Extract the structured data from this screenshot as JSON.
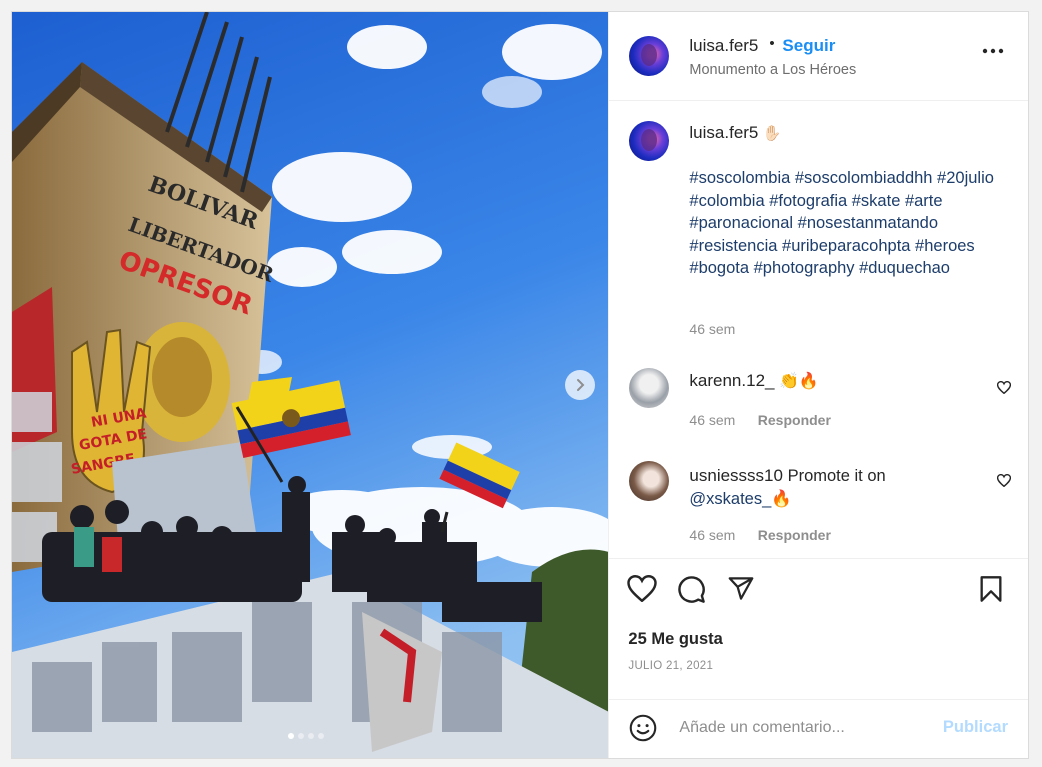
{
  "header": {
    "username": "luisa.fer5",
    "separator": "•",
    "follow_label": "Seguir",
    "location": "Monumento a Los Héroes"
  },
  "caption": {
    "username": "luisa.fer5",
    "emoji": "✋🏻",
    "hashtags": "#soscolombia #soscolombiaddhh #20julio #colombia #fotografia #skate #arte #paronacional #nosestanmatando #resistencia #uribeparacohpta #heroes #bogota #photography #duquechao",
    "time": "46 sem"
  },
  "comments": [
    {
      "username": "karenn.12_",
      "text": "👏🔥",
      "time": "46 sem",
      "reply_label": "Responder"
    },
    {
      "username": "usniessss10",
      "text_line1": "Promote it on",
      "text_line2": "@xskates_🔥",
      "time": "46 sem",
      "reply_label": "Responder"
    }
  ],
  "likes": "25 Me gusta",
  "date": "JULIO 21, 2021",
  "add_comment": {
    "placeholder": "Añade un comentario...",
    "publish_label": "Publicar"
  },
  "carousel": {
    "slide_count": 4,
    "active_index": 0
  },
  "photo": {
    "monument_text": [
      "BOLIVAR",
      "LIBERTADOR",
      "OPRESOR"
    ],
    "mural_text": [
      "NI UNA",
      "GOTA DE",
      "SANGRE"
    ]
  },
  "icons": {
    "like": "heart-icon",
    "comment": "comment-bubble-icon",
    "share": "paper-plane-icon",
    "save": "bookmark-icon",
    "more": "more-options-icon",
    "emoji": "smiley-icon",
    "next": "chevron-right-icon"
  },
  "colors": {
    "accent": "#1a8ef5",
    "publish_disabled": "#b3dbff",
    "muted": "#8e8e8e",
    "hashtag": "#1d3d6b"
  }
}
